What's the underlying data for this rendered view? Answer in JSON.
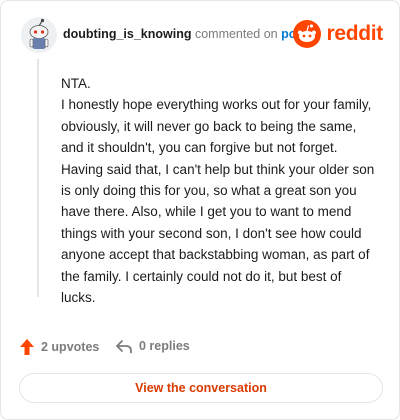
{
  "comment": {
    "username": "doubting_is_knowing",
    "action_text": "commented on",
    "post_link_text": "post",
    "brand": "reddit",
    "body_paragraphs": [
      "NTA.",
      "I honestly hope everything works out for your family, obviously, it will never go back to being the same, and it shouldn't, you can forgive but not forget. Having said that, I can't help but think your older son is only doing this for you, so what a great son you have there. Also, while I get you to want to mend things with your second son, I don't see how could anyone accept that backstabbing woman, as part of the family. I certainly could not do it, but best of lucks."
    ]
  },
  "footer": {
    "upvotes_label": "2 upvotes",
    "replies_label": "0 replies",
    "view_button_label": "View the conversation"
  },
  "icons": {
    "avatar": "snoo-avatar-icon",
    "logo": "reddit-logo-icon",
    "upvote": "upvote-arrow-icon",
    "reply": "reply-arrow-icon"
  },
  "colors": {
    "brand_orange": "#ff4500",
    "link_blue": "#0079d3",
    "button_text": "#d93a00",
    "muted": "#7c7c7c"
  }
}
